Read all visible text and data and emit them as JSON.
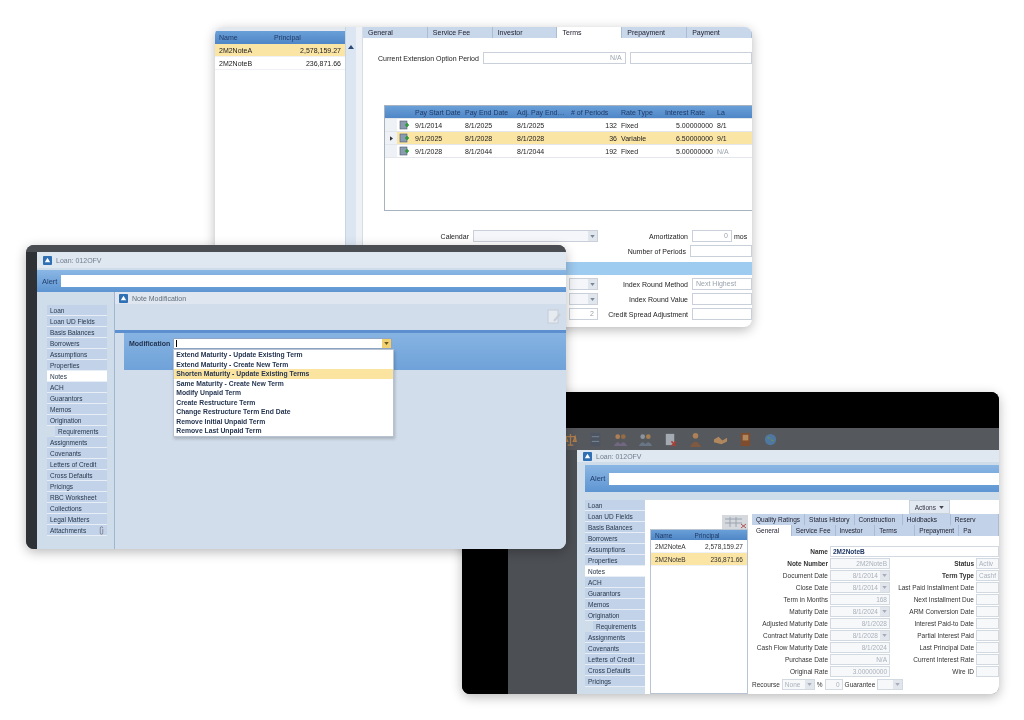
{
  "terms_window": {
    "notes_list": {
      "columns": [
        "Name",
        "Principal"
      ],
      "rows": [
        {
          "name": "2M2NoteA",
          "principal": "2,578,159.27",
          "selected": true
        },
        {
          "name": "2M2NoteB",
          "principal": "236,871.66",
          "selected": false
        }
      ]
    },
    "tabs": [
      {
        "label": "General",
        "selected": false
      },
      {
        "label": "Service Fee",
        "selected": false
      },
      {
        "label": "Investor",
        "selected": false
      },
      {
        "label": "Terms",
        "selected": true
      },
      {
        "label": "Prepayment",
        "selected": false
      },
      {
        "label": "Payment",
        "selected": false
      }
    ],
    "extension_period": {
      "label": "Current Extension Option Period",
      "value": "N/A"
    },
    "terms_grid": {
      "columns": [
        "Pay Start Date",
        "Pay End Date",
        "Adj. Pay End…",
        "# of Periods",
        "Rate Type",
        "Interest Rate",
        "La"
      ],
      "rows": [
        {
          "selected": false,
          "cells": [
            "9/1/2014",
            "8/1/2025",
            "8/1/2025",
            "132",
            "Fixed",
            "5.00000000",
            "8/1"
          ]
        },
        {
          "selected": true,
          "cells": [
            "9/1/2025",
            "8/1/2028",
            "8/1/2028",
            "36",
            "Variable",
            "6.50000000",
            "9/1"
          ]
        },
        {
          "selected": false,
          "cells": [
            "9/1/2028",
            "8/1/2044",
            "8/1/2044",
            "192",
            "Fixed",
            "5.00000000",
            "N/A"
          ]
        }
      ]
    },
    "calendar": {
      "label": "Calendar"
    },
    "amortization": {
      "label": "Amortization",
      "value": "0",
      "unit": "mos"
    },
    "number_of_periods": {
      "label": "Number of Periods"
    },
    "lower_rows": [
      {
        "label": "Index Round Method",
        "value": "Next Highest"
      },
      {
        "label": "Index Round Value"
      },
      {
        "left_value": "2",
        "label": "Credit Spread Adjustment"
      }
    ]
  },
  "modification_window": {
    "title": "Loan: 012OFV",
    "alert_label": "Alert",
    "sidebar": [
      {
        "label": "Loan",
        "selected": false,
        "kind": "page"
      },
      {
        "label": "Loan UD Fields",
        "selected": false,
        "kind": "page"
      },
      {
        "label": "Basis Balances",
        "selected": false,
        "kind": "page"
      },
      {
        "label": "Borrowers",
        "selected": false,
        "kind": "page"
      },
      {
        "label": "Assumptions",
        "selected": false,
        "kind": "page"
      },
      {
        "label": "Properties",
        "selected": false,
        "kind": "page"
      },
      {
        "label": "Notes",
        "selected": true,
        "kind": "page"
      },
      {
        "label": "ACH",
        "selected": false,
        "kind": "page"
      },
      {
        "label": "Guarantors",
        "selected": false,
        "kind": "page"
      },
      {
        "label": "Memos",
        "selected": false,
        "kind": "page"
      },
      {
        "label": "Origination",
        "selected": false,
        "kind": "page",
        "children": [
          {
            "label": "Requirements",
            "selected": false
          }
        ]
      },
      {
        "label": "Assignments",
        "selected": false,
        "kind": "page"
      },
      {
        "label": "Covenants",
        "selected": false,
        "kind": "page"
      },
      {
        "label": "Letters of Credit",
        "selected": false,
        "kind": "page"
      },
      {
        "label": "Cross Defaults",
        "selected": false,
        "kind": "page"
      },
      {
        "label": "Pricings",
        "selected": false,
        "kind": "page"
      },
      {
        "label": "RBC Worksheet",
        "selected": false,
        "kind": "page"
      },
      {
        "label": "Collections",
        "selected": false,
        "kind": "page"
      },
      {
        "label": "Legal Matters",
        "selected": false,
        "kind": "page"
      },
      {
        "label": "Attachments",
        "selected": false,
        "kind": "attachments"
      }
    ],
    "dialog": {
      "title": "Note Modification",
      "field_label": "Modification",
      "options": [
        {
          "label": "Extend Maturity - Update Existing Term",
          "selected": false
        },
        {
          "label": "Extend Maturity - Create New Term",
          "selected": false
        },
        {
          "label": "Shorten Maturity - Update Existing Terms",
          "selected": true
        },
        {
          "label": "Same Maturity - Create New Term",
          "selected": false
        },
        {
          "label": "Modify Unpaid Term",
          "selected": false
        },
        {
          "label": "Create Restructure Term",
          "selected": false
        },
        {
          "label": "Change Restructure Term End Date",
          "selected": false
        },
        {
          "label": "Remove Initial Unpaid Term",
          "selected": false
        },
        {
          "label": "Remove Last Unpaid Term",
          "selected": false
        }
      ]
    }
  },
  "general_window": {
    "title": "Loan: 012OFV",
    "alert_label": "Alert",
    "sidebar": [
      {
        "label": "Loan",
        "selected": false
      },
      {
        "label": "Loan UD Fields",
        "selected": false
      },
      {
        "label": "Basis Balances",
        "selected": false
      },
      {
        "label": "Borrowers",
        "selected": false
      },
      {
        "label": "Assumptions",
        "selected": false
      },
      {
        "label": "Properties",
        "selected": false
      },
      {
        "label": "Notes",
        "selected": true
      },
      {
        "label": "ACH",
        "selected": false
      },
      {
        "label": "Guarantors",
        "selected": false
      },
      {
        "label": "Memos",
        "selected": false
      },
      {
        "label": "Origination",
        "selected": false,
        "children": [
          {
            "label": "Requirements",
            "selected": false
          }
        ]
      },
      {
        "label": "Assignments",
        "selected": false
      },
      {
        "label": "Covenants",
        "selected": false
      },
      {
        "label": "Letters of Credit",
        "selected": false
      },
      {
        "label": "Cross Defaults",
        "selected": false
      },
      {
        "label": "Pricings",
        "selected": false
      }
    ],
    "actions_label": "Actions",
    "notes_list": {
      "columns": [
        "Name",
        "Principal"
      ],
      "rows": [
        {
          "name": "2M2NoteA",
          "principal": "2,578,159.27",
          "selected": false
        },
        {
          "name": "2M2NoteB",
          "principal": "236,871.66",
          "selected": true
        }
      ]
    },
    "tabs_top": [
      {
        "label": "Quality Ratings",
        "selected": false
      },
      {
        "label": "Status History",
        "selected": false
      },
      {
        "label": "Construction",
        "selected": false
      },
      {
        "label": "Holdbacks",
        "selected": false
      },
      {
        "label": "Reserv",
        "selected": false
      }
    ],
    "tabs": [
      {
        "label": "General",
        "selected": true
      },
      {
        "label": "Service Fee",
        "selected": false
      },
      {
        "label": "Investor",
        "selected": false
      },
      {
        "label": "Terms",
        "selected": false
      },
      {
        "label": "Prepayment",
        "selected": false
      },
      {
        "label": "Pa",
        "selected": false
      }
    ],
    "name": {
      "label": "Name",
      "value": "2M2NoteB"
    },
    "fields": [
      {
        "label": "Note Number",
        "value": "2M2NoteB",
        "kind": "text",
        "required": true
      },
      {
        "label": "Document Date",
        "value": "8/1/2014",
        "kind": "date",
        "required": false
      },
      {
        "label": "Close Date",
        "value": "8/1/2014",
        "kind": "date",
        "required": false
      },
      {
        "label": "Term in Months",
        "value": "168",
        "kind": "text",
        "required": false
      },
      {
        "label": "Maturity Date",
        "value": "8/1/2024",
        "kind": "date",
        "required": false
      },
      {
        "label": "Adjusted Maturity Date",
        "value": "8/1/2028",
        "kind": "text",
        "required": false
      },
      {
        "label": "Contract Maturity Date",
        "value": "8/1/2028",
        "kind": "date",
        "required": false
      },
      {
        "label": "Cash Flow Maturity Date",
        "value": "8/1/2024",
        "kind": "text",
        "required": false
      },
      {
        "label": "Purchase Date",
        "value": "N/A",
        "kind": "text",
        "required": false
      },
      {
        "label": "Original Rate",
        "value": "3.00000000",
        "kind": "text",
        "required": false
      }
    ],
    "right_fields": [
      {
        "label": "Status",
        "value": "Activ",
        "required": true
      },
      {
        "label": "Term Type",
        "value": "Cashf",
        "required": true
      },
      {
        "label": "Last Paid Installment Date",
        "required": false
      },
      {
        "label": "Next Installment Due",
        "required": false
      },
      {
        "label": "ARM Conversion Date",
        "required": false
      },
      {
        "label": "Interest Paid-to Date",
        "required": false
      },
      {
        "label": "Partial Interest Paid",
        "required": false
      },
      {
        "label": "Last Principal Date",
        "required": false
      },
      {
        "label": "Current Interest Rate",
        "required": false
      },
      {
        "label": "Wire ID",
        "required": false
      }
    ],
    "recourse": {
      "label": "Recourse",
      "value": "None",
      "percent_sign": "%",
      "percent_value": "0",
      "guarantee_label": "Guarantee"
    }
  }
}
